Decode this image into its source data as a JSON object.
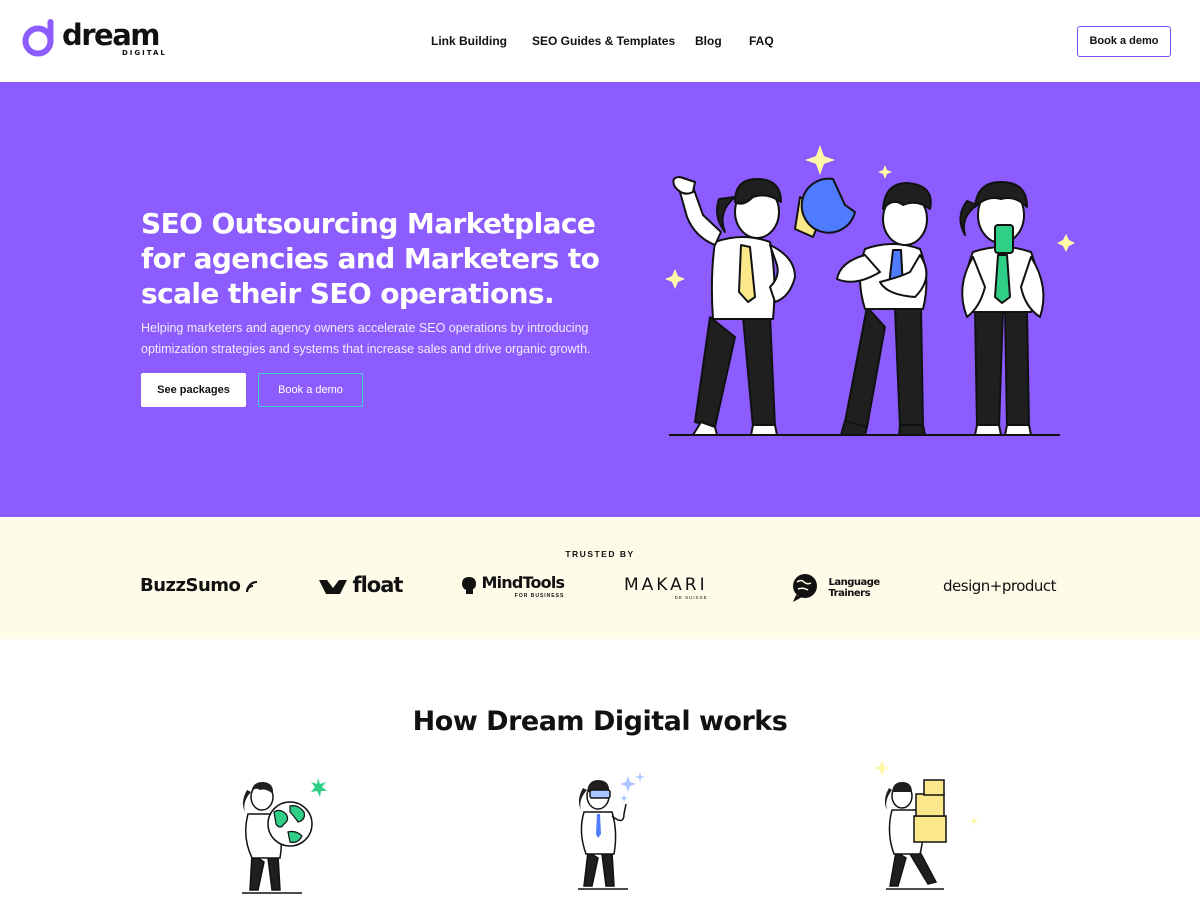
{
  "brand": {
    "name": "dream",
    "tagline": "DIGITAL",
    "accent": "#8c5cff"
  },
  "nav": {
    "items": [
      {
        "label": "Link Building"
      },
      {
        "label": "SEO Guides & Templates"
      },
      {
        "label": "Blog"
      },
      {
        "label": "FAQ"
      }
    ],
    "cta": "Book a demo"
  },
  "hero": {
    "title": "SEO Outsourcing Marketplace for agencies and Marketers to scale their SEO operations.",
    "subtitle": "Helping marketers and agency owners accelerate SEO operations by introducing optimization strategies and systems that increase sales and drive organic growth.",
    "primary_button": "See packages",
    "secondary_button": "Book a demo",
    "background": "#8c5cff"
  },
  "trusted": {
    "label": "TRUSTED BY",
    "logos": [
      {
        "name": "BuzzSumo"
      },
      {
        "name": "float"
      },
      {
        "name": "MindTools",
        "sub": "FOR BUSINESS"
      },
      {
        "name": "MAKARI",
        "sub": "DE SUISSE"
      },
      {
        "name": "Language",
        "name2": "Trainers"
      },
      {
        "name": "design+product"
      }
    ],
    "background": "#fefbe9"
  },
  "how": {
    "title": "How Dream Digital works"
  }
}
